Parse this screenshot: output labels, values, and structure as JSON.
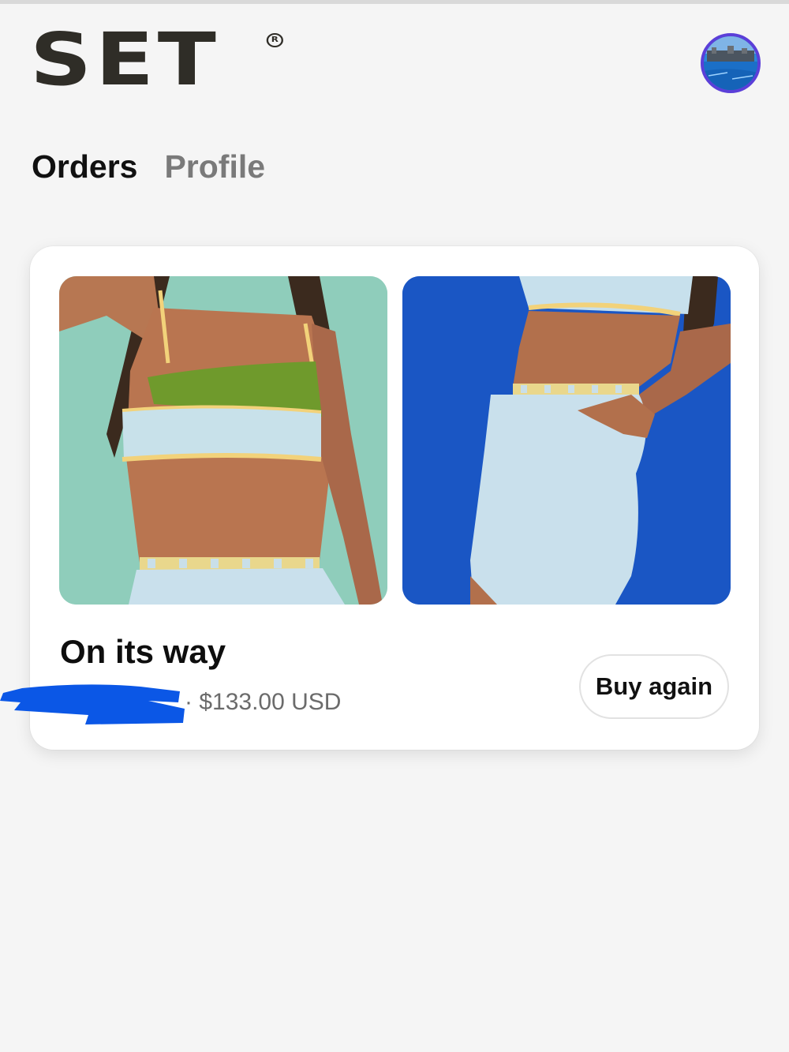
{
  "brand": {
    "logo_text": "SET",
    "registered_mark": "R"
  },
  "header": {
    "avatar_icon": "avatar-photo"
  },
  "tabs": [
    {
      "label": "Orders",
      "active": true
    },
    {
      "label": "Profile",
      "active": false
    }
  ],
  "order": {
    "status": "On its way",
    "price_text": "· $133.00 USD",
    "buy_again_label": "Buy again",
    "images": [
      {
        "name": "product-image-sports-bra",
        "bg": "#8fcdbb"
      },
      {
        "name": "product-image-biker-shorts",
        "bg": "#1a56c4"
      }
    ]
  },
  "colors": {
    "background": "#f5f5f5",
    "card": "#ffffff",
    "text_primary": "#111111",
    "text_secondary": "#6b6b6b",
    "avatar_ring": "#5b3fd8",
    "redaction": "#0b57e6"
  }
}
